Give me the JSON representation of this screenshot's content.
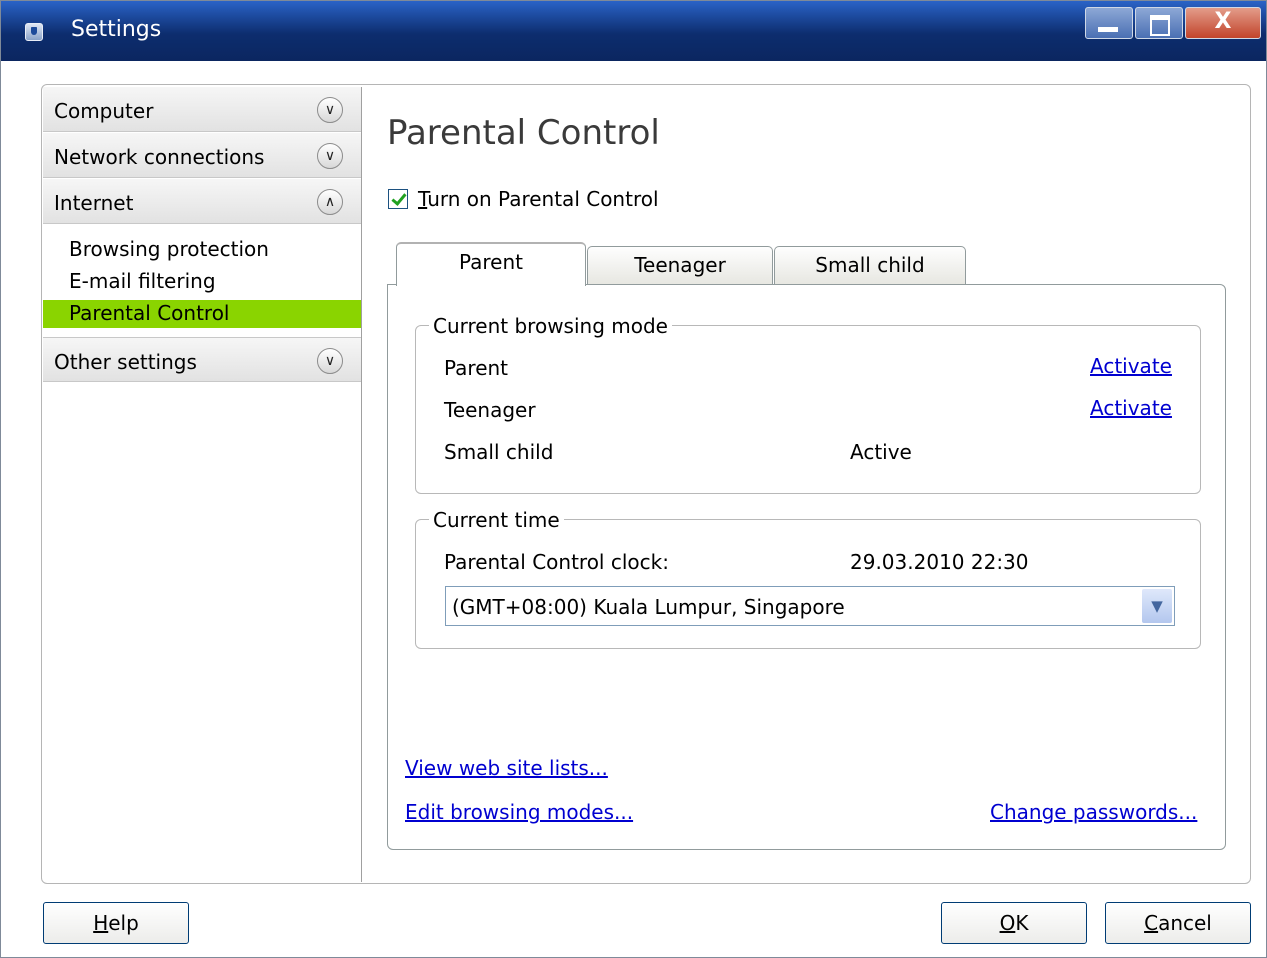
{
  "window": {
    "title": "Settings",
    "close_glyph": "X"
  },
  "sidebar": {
    "sections": [
      {
        "label": "Computer",
        "state": "collapsed"
      },
      {
        "label": "Network connections",
        "state": "collapsed"
      },
      {
        "label": "Internet",
        "state": "expanded"
      },
      {
        "label": "Other settings",
        "state": "collapsed"
      }
    ],
    "internet_items": [
      "Browsing protection",
      "E-mail filtering",
      "Parental Control"
    ],
    "selected_item": "Parental Control",
    "selected_color": "#8ad400"
  },
  "main": {
    "heading": "Parental Control",
    "enable_checkbox": {
      "label": "Turn on Parental Control",
      "checked": true
    },
    "tabs": [
      {
        "label": "Parent",
        "active": true
      },
      {
        "label": "Teenager",
        "active": false
      },
      {
        "label": "Small child",
        "active": false
      }
    ],
    "browsing_mode": {
      "legend": "Current browsing mode",
      "rows": [
        {
          "name": "Parent",
          "status": "Activate",
          "is_link": true
        },
        {
          "name": "Teenager",
          "status": "Activate",
          "is_link": true
        },
        {
          "name": "Small child",
          "status": "Active",
          "is_link": false
        }
      ]
    },
    "current_time": {
      "legend": "Current time",
      "clock_label": "Parental Control clock:",
      "clock_value": "29.03.2010 22:30",
      "timezone": "(GMT+08:00) Kuala Lumpur, Singapore"
    },
    "links": {
      "view_sites": "View web site lists...",
      "edit_modes": "Edit browsing modes...",
      "change_passwords": "Change passwords..."
    }
  },
  "buttons": {
    "help": "Help",
    "ok": "OK",
    "cancel": "Cancel"
  },
  "icons": {
    "section_collapsed": "chevron-down-icon",
    "section_expanded": "chevron-up-icon",
    "dropdown": "dropdown-arrow-icon"
  }
}
